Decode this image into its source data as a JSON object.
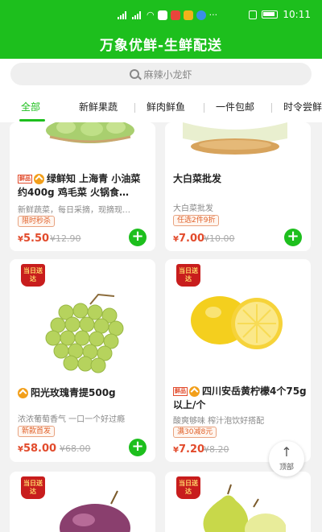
{
  "status_bar": {
    "time": "10:11"
  },
  "header": {
    "title": "万象优鲜-生鲜配送"
  },
  "search": {
    "placeholder": "麻辣小龙虾"
  },
  "tabs": [
    {
      "label": "全部",
      "active": true
    },
    {
      "label": "新鲜果蔬"
    },
    {
      "label": "鲜肉鲜鱼"
    },
    {
      "label": "一件包邮"
    },
    {
      "label": "时令尝鲜"
    }
  ],
  "badges": {
    "fresh": "鲜品",
    "daily_delivery": "当日送达"
  },
  "products": [
    {
      "name": "绿鲜知 上海青 小油菜 约400g 鸡毛菜 火锅食…",
      "desc": "新鲜蔬菜，每日采摘，现摘现…",
      "tag": "限时秒杀",
      "price": "5.50",
      "old_price": "¥12.90"
    },
    {
      "name": "大白菜批发",
      "desc": "大白菜批发",
      "tag": "任选2件9折",
      "price": "7.00",
      "old_price": "¥10.00"
    },
    {
      "name": "阳光玫瑰青提500g",
      "desc": "浓浓葡萄香气 一口一个好过瘾",
      "tag": "新款首发",
      "price": "58.00",
      "old_price": "¥68.00"
    },
    {
      "name": "四川安岳黄柠檬4个75g以上/个",
      "desc": "酸爽够味 榨汁泡饮好搭配",
      "tag": "满30减8元",
      "price": "7.20",
      "old_price": "¥8.20"
    }
  ],
  "back_to_top": {
    "label": "顶部"
  },
  "colors": {
    "brand": "#1dbf1d",
    "price": "#e24b2c",
    "tag": "#e0622b"
  }
}
